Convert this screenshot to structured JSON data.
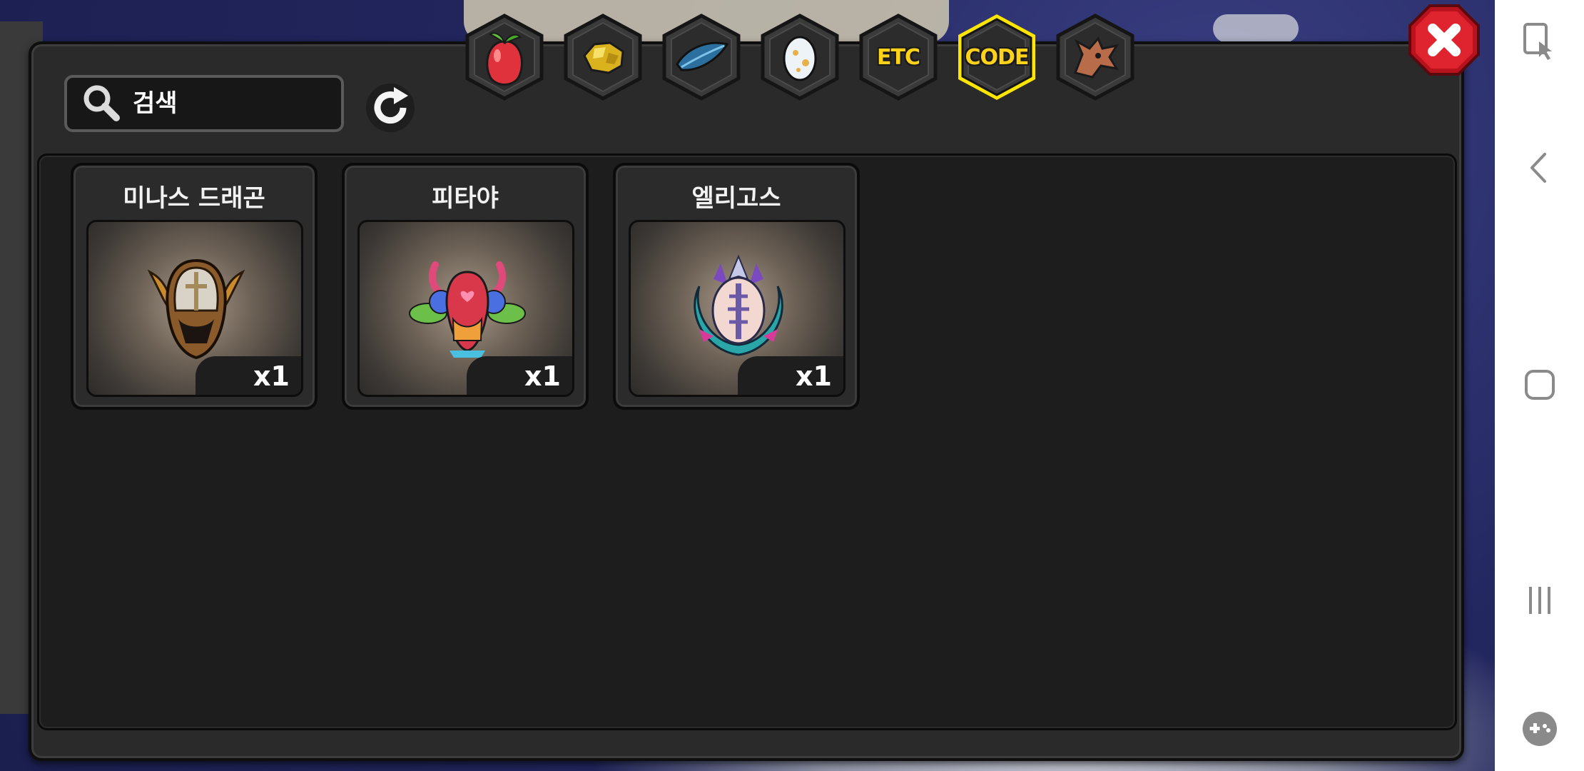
{
  "search": {
    "placeholder": "검색"
  },
  "tabs": [
    {
      "name": "fruit",
      "icon": "fruit-icon"
    },
    {
      "name": "gold",
      "icon": "gold-ore-icon"
    },
    {
      "name": "feather",
      "icon": "feather-icon"
    },
    {
      "name": "egg",
      "icon": "egg-icon"
    },
    {
      "name": "etc",
      "label": "ETC"
    },
    {
      "name": "code",
      "label": "CODE",
      "selected": true
    },
    {
      "name": "dragon",
      "icon": "dragon-head-icon"
    }
  ],
  "items": [
    {
      "name": "미나스 드래곤",
      "quantity": "x1",
      "icon": "winged-helmet-emblem"
    },
    {
      "name": "피타야",
      "quantity": "x1",
      "icon": "floral-crab-emblem"
    },
    {
      "name": "엘리고스",
      "quantity": "x1",
      "icon": "crystal-dragon-emblem"
    }
  ],
  "colors": {
    "selected_tab_border": "#ffe600",
    "tab_label": "#ffd21a",
    "close_button": "#d81e2a",
    "panel_bg": "#2a2a2a",
    "content_bg": "#1d1d1d"
  },
  "system_nav": [
    {
      "name": "touch-assist",
      "icon": "touch-assist-icon"
    },
    {
      "name": "back",
      "icon": "back-chevron-icon"
    },
    {
      "name": "home",
      "icon": "home-square-icon"
    },
    {
      "name": "recents",
      "icon": "recent-apps-icon"
    },
    {
      "name": "game-tools",
      "icon": "gamepad-icon"
    }
  ]
}
